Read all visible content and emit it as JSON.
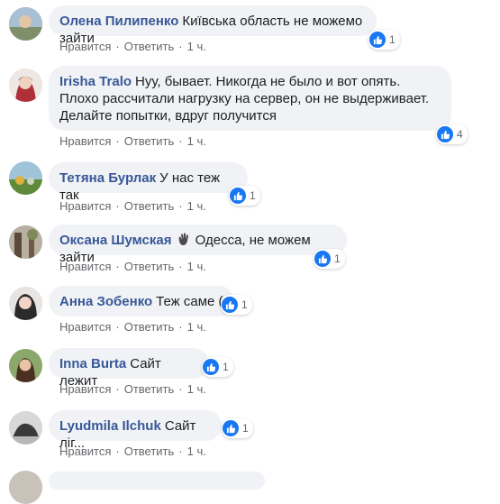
{
  "actions": {
    "like": "Нравится",
    "reply": "Ответить",
    "sep": "·",
    "time": "1 ч."
  },
  "comments": [
    {
      "author": "Олена Пилипенко",
      "text": "Київська область не можемо зайти",
      "likes": "1"
    },
    {
      "author": "Irisha Tralo",
      "text": "Нуу, бывает. Никогда не было и вот опять. Плохо рассчитали нагрузку на сервер, он не выдерживает. Делайте попытки, вдруг получится",
      "likes": "4"
    },
    {
      "author": "Тетяна Бурлак",
      "text": "У нас теж так",
      "likes": "1"
    },
    {
      "author": "Оксана Шумская",
      "text": "Одесса, не можем зайти",
      "likes": "1"
    },
    {
      "author": "Анна Зобенко",
      "text": "Теж саме (",
      "likes": "1"
    },
    {
      "author": "Inna Burta",
      "text": "Сайт лежит",
      "likes": "1"
    },
    {
      "author": "Lyudmila Ilchuk",
      "text": "Сайт ліг...",
      "likes": "1"
    }
  ]
}
